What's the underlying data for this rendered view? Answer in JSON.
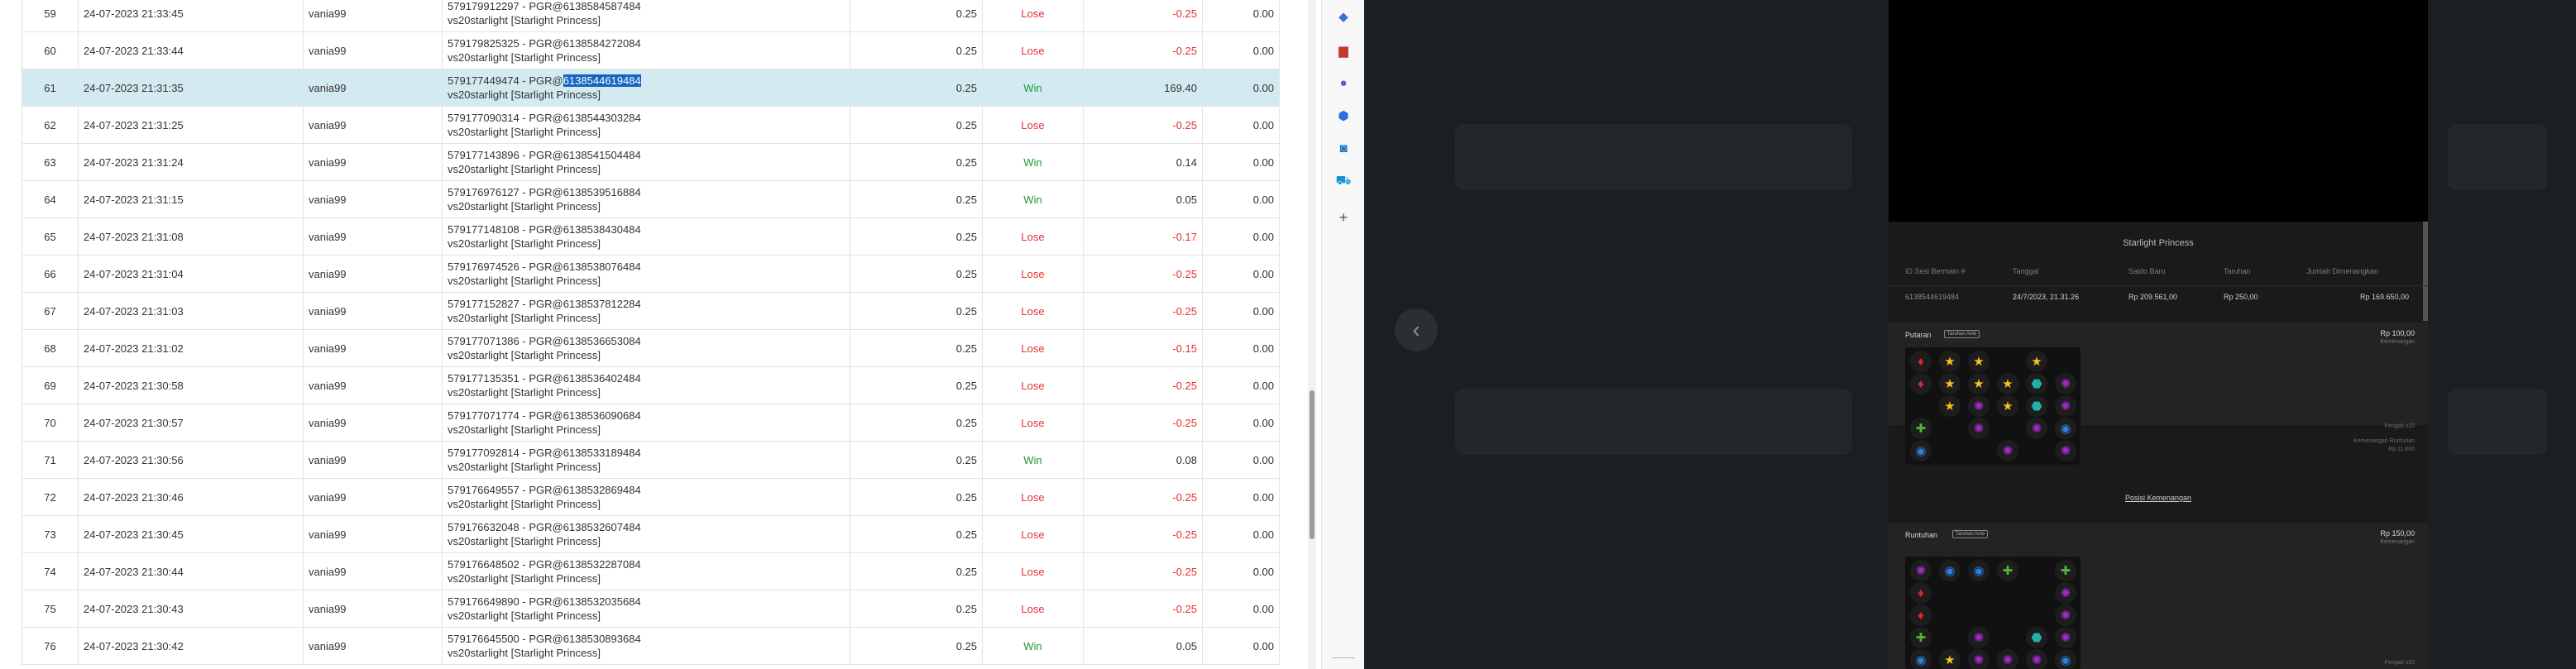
{
  "rows": [
    {
      "no": "59",
      "time": "24-07-2023 21:33:45",
      "user": "vania99",
      "id": "579179912297",
      "pgr": "PGR@6138584587484",
      "game": "vs20starlight [Starlight Princess]",
      "bet": "0.25",
      "result": "Lose",
      "amount": "-0.25",
      "balance": "0.00"
    },
    {
      "no": "60",
      "time": "24-07-2023 21:33:44",
      "user": "vania99",
      "id": "579179825325",
      "pgr": "PGR@6138584272084",
      "game": "vs20starlight [Starlight Princess]",
      "bet": "0.25",
      "result": "Lose",
      "amount": "-0.25",
      "balance": "0.00"
    },
    {
      "no": "61",
      "time": "24-07-2023 21:31:35",
      "user": "vania99",
      "id": "579177449474",
      "pgr_prefix": "PGR@",
      "pgr_selected": "6138544619484",
      "game": "vs20starlight [Starlight Princess]",
      "bet": "0.25",
      "result": "Win",
      "amount": "169.40",
      "balance": "0.00",
      "selected": true
    },
    {
      "no": "62",
      "time": "24-07-2023 21:31:25",
      "user": "vania99",
      "id": "579177090314",
      "pgr": "PGR@6138544303284",
      "game": "vs20starlight [Starlight Princess]",
      "bet": "0.25",
      "result": "Lose",
      "amount": "-0.25",
      "balance": "0.00"
    },
    {
      "no": "63",
      "time": "24-07-2023 21:31:24",
      "user": "vania99",
      "id": "579177143896",
      "pgr": "PGR@6138541504484",
      "game": "vs20starlight [Starlight Princess]",
      "bet": "0.25",
      "result": "Win",
      "amount": "0.14",
      "balance": "0.00"
    },
    {
      "no": "64",
      "time": "24-07-2023 21:31:15",
      "user": "vania99",
      "id": "579176976127",
      "pgr": "PGR@6138539516884",
      "game": "vs20starlight [Starlight Princess]",
      "bet": "0.25",
      "result": "Win",
      "amount": "0.05",
      "balance": "0.00"
    },
    {
      "no": "65",
      "time": "24-07-2023 21:31:08",
      "user": "vania99",
      "id": "579177148108",
      "pgr": "PGR@6138538430484",
      "game": "vs20starlight [Starlight Princess]",
      "bet": "0.25",
      "result": "Lose",
      "amount": "-0.17",
      "balance": "0.00"
    },
    {
      "no": "66",
      "time": "24-07-2023 21:31:04",
      "user": "vania99",
      "id": "579176974526",
      "pgr": "PGR@6138538076484",
      "game": "vs20starlight [Starlight Princess]",
      "bet": "0.25",
      "result": "Lose",
      "amount": "-0.25",
      "balance": "0.00"
    },
    {
      "no": "67",
      "time": "24-07-2023 21:31:03",
      "user": "vania99",
      "id": "579177152827",
      "pgr": "PGR@6138537812284",
      "game": "vs20starlight [Starlight Princess]",
      "bet": "0.25",
      "result": "Lose",
      "amount": "-0.25",
      "balance": "0.00"
    },
    {
      "no": "68",
      "time": "24-07-2023 21:31:02",
      "user": "vania99",
      "id": "579177071386",
      "pgr": "PGR@6138536653084",
      "game": "vs20starlight [Starlight Princess]",
      "bet": "0.25",
      "result": "Lose",
      "amount": "-0.15",
      "balance": "0.00"
    },
    {
      "no": "69",
      "time": "24-07-2023 21:30:58",
      "user": "vania99",
      "id": "579177135351",
      "pgr": "PGR@6138536402484",
      "game": "vs20starlight [Starlight Princess]",
      "bet": "0.25",
      "result": "Lose",
      "amount": "-0.25",
      "balance": "0.00"
    },
    {
      "no": "70",
      "time": "24-07-2023 21:30:57",
      "user": "vania99",
      "id": "579177071774",
      "pgr": "PGR@6138536090684",
      "game": "vs20starlight [Starlight Princess]",
      "bet": "0.25",
      "result": "Lose",
      "amount": "-0.25",
      "balance": "0.00"
    },
    {
      "no": "71",
      "time": "24-07-2023 21:30:56",
      "user": "vania99",
      "id": "579177092814",
      "pgr": "PGR@6138533189484",
      "game": "vs20starlight [Starlight Princess]",
      "bet": "0.25",
      "result": "Win",
      "amount": "0.08",
      "balance": "0.00"
    },
    {
      "no": "72",
      "time": "24-07-2023 21:30:46",
      "user": "vania99",
      "id": "579176649557",
      "pgr": "PGR@6138532869484",
      "game": "vs20starlight [Starlight Princess]",
      "bet": "0.25",
      "result": "Lose",
      "amount": "-0.25",
      "balance": "0.00"
    },
    {
      "no": "73",
      "time": "24-07-2023 21:30:45",
      "user": "vania99",
      "id": "579176632048",
      "pgr": "PGR@6138532607484",
      "game": "vs20starlight [Starlight Princess]",
      "bet": "0.25",
      "result": "Lose",
      "amount": "-0.25",
      "balance": "0.00"
    },
    {
      "no": "74",
      "time": "24-07-2023 21:30:44",
      "user": "vania99",
      "id": "579176648502",
      "pgr": "PGR@6138532287084",
      "game": "vs20starlight [Starlight Princess]",
      "bet": "0.25",
      "result": "Lose",
      "amount": "-0.25",
      "balance": "0.00"
    },
    {
      "no": "75",
      "time": "24-07-2023 21:30:43",
      "user": "vania99",
      "id": "579176649890",
      "pgr": "PGR@6138532035684",
      "game": "vs20starlight [Starlight Princess]",
      "bet": "0.25",
      "result": "Lose",
      "amount": "-0.25",
      "balance": "0.00"
    },
    {
      "no": "76",
      "time": "24-07-2023 21:30:42",
      "user": "vania99",
      "id": "579176645500",
      "pgr": "PGR@6138530893684",
      "game": "vs20starlight [Starlight Princess]",
      "bet": "0.25",
      "result": "Win",
      "amount": "0.05",
      "balance": "0.00"
    }
  ],
  "sidebar_icons": [
    "tag-icon",
    "briefcase-icon",
    "people-icon",
    "hexagon-icon",
    "outlook-icon",
    "cart-icon",
    "plus-icon"
  ],
  "colors": {
    "lose": "#e8312f",
    "win": "#1e9a37",
    "selected_row": "#d3eaf1",
    "highlight": "#1565c0"
  },
  "game_panel": {
    "title": "Starlight Princess",
    "headers": {
      "round_id": "ID Sesi Bermain #",
      "date": "Tanggal",
      "balance": "Saldo Baru",
      "bet": "Taruhan",
      "win": "Jumlah Dimenangkan"
    },
    "row": {
      "round_id": "6138544619484",
      "date": "24/7/2023, 21.31.26",
      "balance": "Rp 209.561,00",
      "bet": "Rp 250,00",
      "win": "Rp 169.650,00"
    },
    "spin_section": {
      "title": "Putaran",
      "chip": "Taruhan Ante",
      "amount": "Rp 100,00",
      "sub": "Kemenangan",
      "note1": "Pengali x20",
      "note2": "Kemenangan Runtuhan",
      "note3": "Rp 11.600",
      "link": "Posisi Kemenangan"
    },
    "tumble_section": {
      "title": "Runtuhan",
      "chip": "Taruhan Ante",
      "amount": "Rp 150,00",
      "sub": "Kemenangan",
      "note1": "Pengali x20"
    }
  }
}
